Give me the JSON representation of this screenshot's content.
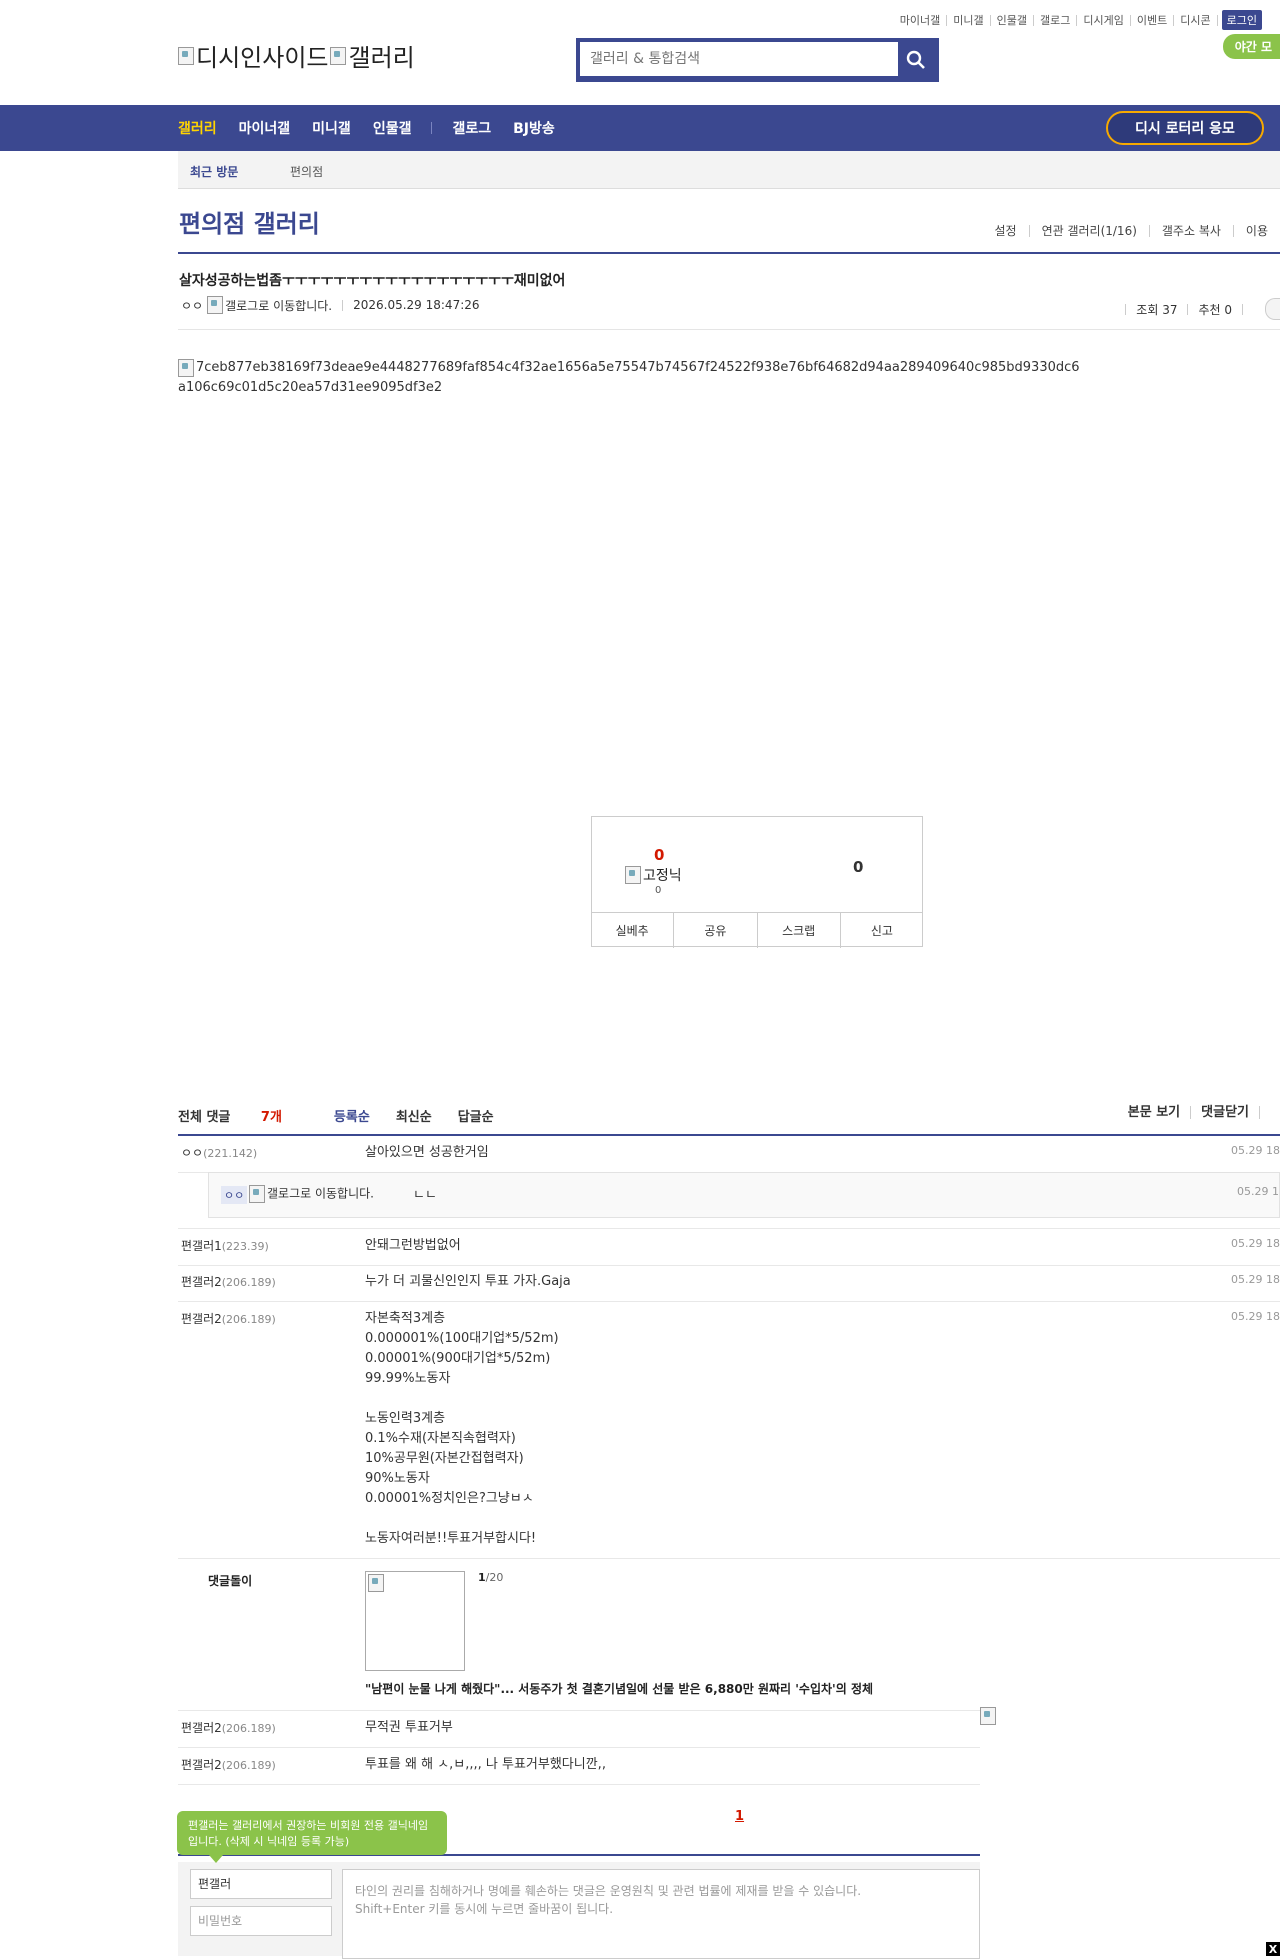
{
  "util": {
    "links": [
      "마이너갤",
      "미니갤",
      "인물갤",
      "갤로그",
      "디시게임",
      "이벤트",
      "디시콘"
    ],
    "login": "로그인",
    "night": "야간 모"
  },
  "logo": {
    "alt1": "디시인사이드",
    "alt2": "갤러리"
  },
  "search": {
    "placeholder": "갤러리 & 통합검색"
  },
  "nav": {
    "items": [
      "갤러리",
      "마이너갤",
      "미니갤",
      "인물갤"
    ],
    "items2": [
      "갤로그",
      "BJ방송"
    ],
    "lotto": "디시 로터리 응모"
  },
  "subnav": {
    "recent": "최근 방문",
    "gallery": "편의점"
  },
  "gallery": {
    "title": "편의점 갤러리",
    "menu": [
      "설정",
      "연관 갤러리(1/16)",
      "갤주소 복사",
      "이용"
    ]
  },
  "post": {
    "title": "살자성공하는법좀ㅜㅜㅜㅜㅜㅜㅜㅜㅜㅜㅜㅜㅜㅜㅜㅜㅜㅜ재미없어",
    "writer": "ㅇㅇ",
    "gallog_alt": "갤로그로 이동합니다.",
    "date": "2026.05.29 18:47:26",
    "views": "조회 37",
    "recommend": "추천 0",
    "image_alt": "7ceb877eb38169f73deae9e4448277689faf854c4f32ae1656a5e75547b74567f24522f938e76bf64682d94aa289409640c985bd9330dc6a106c69c01d5c20ea57d31ee9095df3e2"
  },
  "recommend_box": {
    "up": "0",
    "fixnick_alt": "고정닉",
    "fixnick_count": "0",
    "down": "0",
    "buttons": [
      "실베추",
      "공유",
      "스크랩",
      "신고"
    ]
  },
  "comments_header": {
    "total_label": "전체 댓글",
    "total_count": "7개",
    "sorts": [
      "등록순",
      "최신순",
      "답글순"
    ],
    "right": [
      "본문 보기",
      "댓글닫기"
    ]
  },
  "comments": [
    {
      "nick": "ㅇㅇ",
      "ip": "(221.142)",
      "text": "살아있으면 성공한거임",
      "date": "05.29 18"
    },
    {
      "nick": "편갤러1",
      "ip": "(223.39)",
      "text": "안돼그런방법없어",
      "date": "05.29 18"
    },
    {
      "nick": "편갤러2",
      "ip": "(206.189)",
      "text": "누가 더 괴물신인인지 투표 가자.Gaja",
      "date": "05.29 18"
    },
    {
      "nick": "편갤러2",
      "ip": "(206.189)",
      "text": "자본축적3계층\n0.000001%(100대기업*5/52m)\n0.00001%(900대기업*5/52m)\n99.99%노동자\n\n노동인력3계층\n0.1%수재(자본직속협력자)\n10%공무원(자본간접협력자)\n90%노동자\n0.00001%정치인은?그냥ㅂㅅ\n\n노동자여러분!!투표거부합시다!",
      "date": "05.29 18"
    },
    {
      "nick": "편갤러2",
      "ip": "(206.189)",
      "text": "무적권 투표거부",
      "date": ""
    },
    {
      "nick": "편갤러2",
      "ip": "(206.189)",
      "text": "투표를 왜 해 ㅅ,ㅂ,,,, 나 투표거부했다니깐,,",
      "date": ""
    }
  ],
  "reply": {
    "nick": "ㅇㅇ",
    "gallog_alt": "갤로그로 이동합니다.",
    "text": "ㄴㄴ",
    "date": "05.29 1"
  },
  "dgl": {
    "label": "댓글돌이",
    "page_current": "1",
    "page_total": "/20",
    "news": "\"남편이 눈물 나게 해줬다\"... 서동주가 첫 결혼기념일에 선물 받은 6,880만 원짜리 '수입차'의 정체"
  },
  "pagination": {
    "current": "1"
  },
  "write": {
    "tip": "편갤러는 갤러리에서 권장하는 비회원 전용 갤닉네임입니다. (삭제 시 닉네임 등록 가능)",
    "nick": "편갤러",
    "password_placeholder": "비밀번호",
    "textarea_line1": "타인의 권리를 침해하거나 명예를 훼손하는 댓글은 운영원칙 및 관련 법률에 제재를 받을 수 있습니다.",
    "textarea_line2": "Shift+Enter 키를 동시에 누르면 줄바꿈이 됩니다."
  },
  "close": "X",
  "colors": {
    "brand": "#3b4890",
    "accent": "#d31900",
    "highlight": "#ffd400",
    "green": "#8bc34a",
    "lotto_border": "#f7a900"
  }
}
